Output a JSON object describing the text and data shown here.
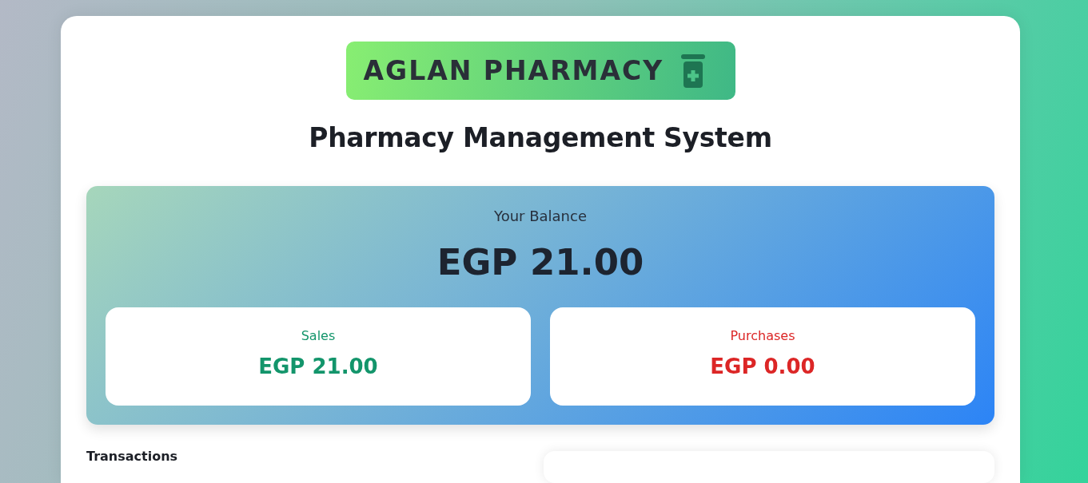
{
  "logo": {
    "text": "AGLAN PHARMACY"
  },
  "title": "Pharmacy Management System",
  "balance": {
    "label": "Your Balance",
    "amount": "EGP 21.00"
  },
  "summary": [
    {
      "label": "Sales",
      "amount": "EGP 21.00",
      "color": "#13956b"
    },
    {
      "label": "Purchases",
      "amount": "EGP 0.00",
      "color": "#dc2626"
    }
  ],
  "transactions": {
    "heading": "Transactions"
  }
}
